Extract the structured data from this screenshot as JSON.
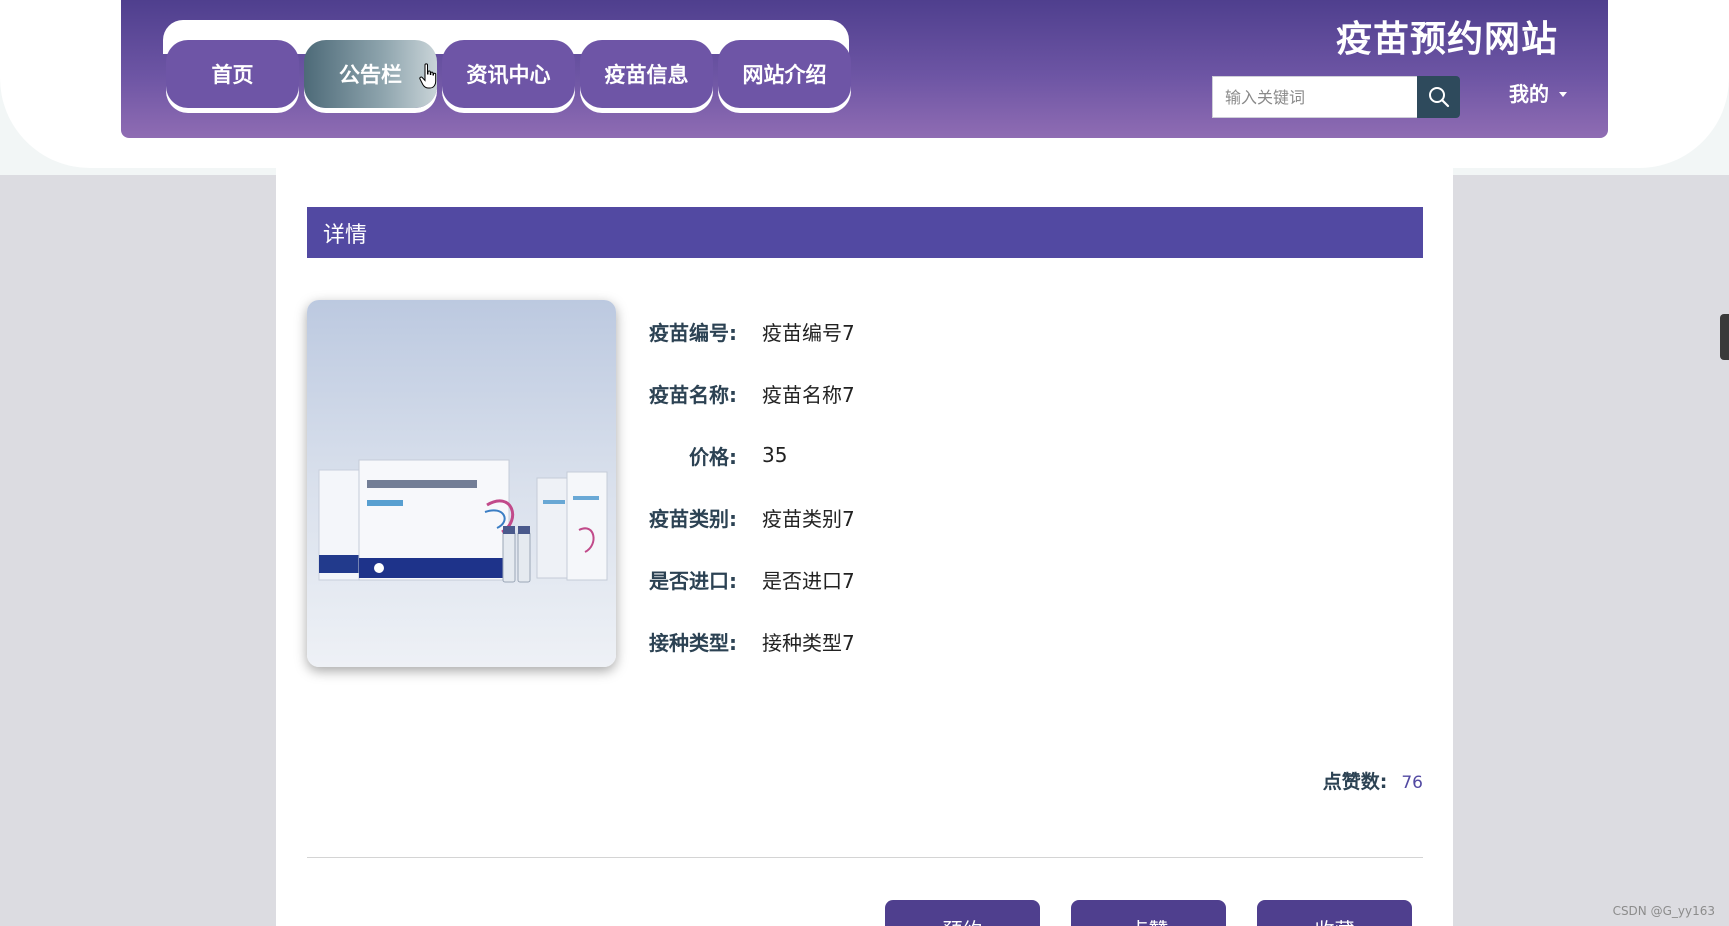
{
  "header": {
    "site_title": "疫苗预约网站",
    "nav": [
      {
        "label": "首页",
        "active": false
      },
      {
        "label": "公告栏",
        "active": true
      },
      {
        "label": "资讯中心",
        "active": false
      },
      {
        "label": "疫苗信息",
        "active": false
      },
      {
        "label": "网站介绍",
        "active": false
      }
    ],
    "search": {
      "placeholder": "输入关键词",
      "icon": "search-icon"
    },
    "my_menu": "我的"
  },
  "detail": {
    "section_title": "详情",
    "fields": [
      {
        "label": "疫苗编号:",
        "value": "疫苗编号7"
      },
      {
        "label": "疫苗名称:",
        "value": "疫苗名称7"
      },
      {
        "label": "价格:",
        "value": "35"
      },
      {
        "label": "疫苗类别:",
        "value": "疫苗类别7"
      },
      {
        "label": "是否进口:",
        "value": "是否进口7"
      },
      {
        "label": "接种类型:",
        "value": "接种类型7"
      }
    ],
    "likes_label": "点赞数:",
    "likes_value": "76",
    "actions": [
      "预约",
      "点赞",
      "收藏"
    ]
  },
  "watermark": "CSDN @G_yy163",
  "colors": {
    "header_gradient_top": "#4f3f8e",
    "header_gradient_bottom": "#8f6cb3",
    "accent": "#5249a2",
    "search_button": "#2e4a5c"
  }
}
